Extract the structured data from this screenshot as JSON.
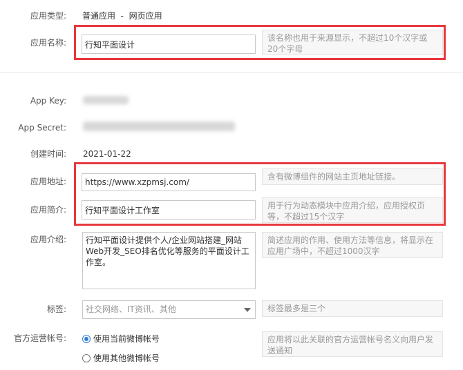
{
  "app_type": {
    "label": "应用类型:",
    "value": "普通应用  -  网页应用"
  },
  "app_name": {
    "label": "应用名称:",
    "value": "行知平面设计",
    "hint": "该名称也用于来源显示，不超过10个汉字或20个字母"
  },
  "app_key": {
    "label": "App Key:"
  },
  "app_secret": {
    "label": "App Secret:"
  },
  "created_time": {
    "label": "创建时间:",
    "value": "2021-01-22"
  },
  "app_url": {
    "label": "应用地址:",
    "value": "https://www.xzpmsj.com/",
    "hint": "含有微博组件的网站主页地址链接。"
  },
  "app_summary": {
    "label": "应用简介:",
    "value": "行知平面设计工作室",
    "hint": "用于行为动态模块中应用介绍，应用授权页等，不超过15个汉字"
  },
  "app_intro": {
    "label": "应用介绍:",
    "value": "行知平面设计提供个人/企业网站搭建_网站Web开发_SEO排名优化等服务的平面设计工作室。",
    "hint": "简述应用的作用、使用方法等信息，将显示在应用广场中，不超过1000汉字"
  },
  "tags": {
    "label": "标签:",
    "placeholder": "社交网络、IT资讯、其他",
    "hint": "标签最多是三个"
  },
  "official_account": {
    "label": "官方运营帐号:",
    "options": [
      {
        "label": "使用当前微博帐号",
        "checked": true
      },
      {
        "label": "使用其他微博帐号",
        "checked": false
      }
    ],
    "hint": "应用将以此关联的官方运营帐号名义向用户发送通知"
  },
  "colors": {
    "highlight": "#e8383d",
    "accent": "#2f7cd8"
  }
}
